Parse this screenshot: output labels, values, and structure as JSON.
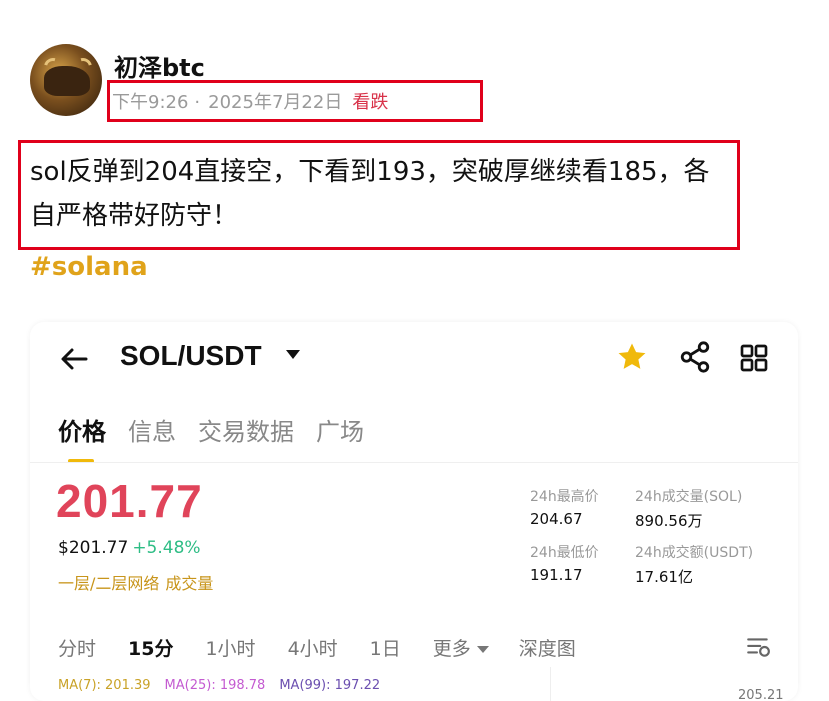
{
  "post": {
    "username": "初泽btc",
    "time": "下午9:26",
    "date": "2025年7月22日",
    "sentiment": "看跌",
    "text": "sol反弹到204直接空，下看到193，突破厚继续看185，各自严格带好防守！",
    "hashtag": "#solana"
  },
  "card": {
    "pair": "SOL/USDT",
    "tabs": [
      "价格",
      "信息",
      "交易数据",
      "广场"
    ],
    "active_tab": 0,
    "price": "201.77",
    "usd_price": "$201.77",
    "change": "+5.48%",
    "layer": "一层/二层网络",
    "volume_tag": "成交量",
    "stats": {
      "high_label": "24h最高价",
      "high": "204.67",
      "low_label": "24h最低价",
      "low": "191.17",
      "vol_sol_label": "24h成交量(SOL)",
      "vol_sol": "890.56万",
      "vol_usdt_label": "24h成交额(USDT)",
      "vol_usdt": "17.61亿"
    },
    "timeframes": [
      "分时",
      "15分",
      "1小时",
      "4小时",
      "1日",
      "更多",
      "深度图"
    ],
    "active_timeframe": 1,
    "ma": {
      "ma7": "MA(7): 201.39",
      "ma25": "MA(25): 198.78",
      "ma99": "MA(99): 197.22"
    },
    "axis_top": "205.21"
  },
  "colors": {
    "highlight_box": "#e0001b",
    "price_red": "#e0445a",
    "change_green": "#2ebd85",
    "accent_gold": "#f0b90b",
    "hashtag": "#e0a31a",
    "sentiment": "#d8334a"
  }
}
